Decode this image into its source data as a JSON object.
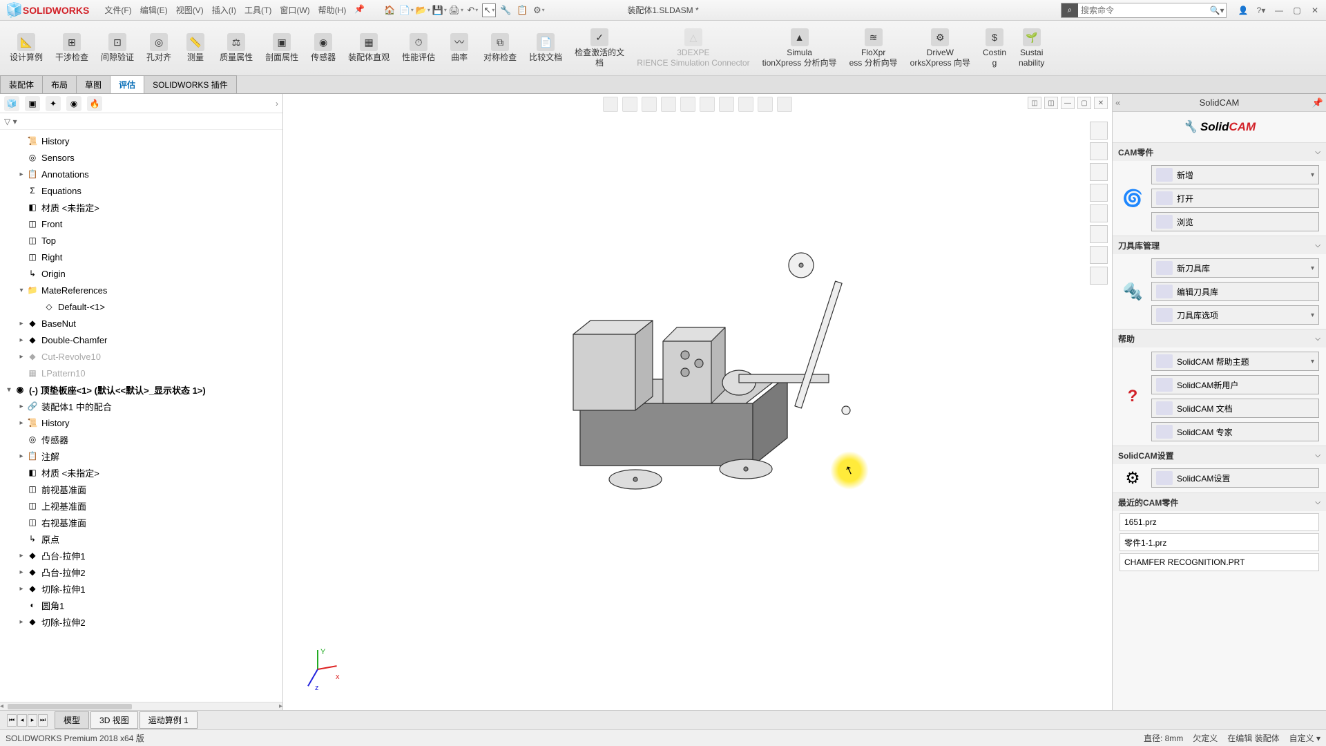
{
  "app": {
    "name": "SOLIDWORKS",
    "doc_title": "装配体1.SLDASM *"
  },
  "menu": [
    "文件(F)",
    "编辑(E)",
    "视图(V)",
    "插入(I)",
    "工具(T)",
    "窗口(W)",
    "帮助(H)"
  ],
  "search": {
    "placeholder": "搜索命令"
  },
  "ribbon": [
    {
      "lbl": "设计算例",
      "ic": "📐"
    },
    {
      "lbl": "干涉检查",
      "ic": "⊞"
    },
    {
      "lbl": "间隙验证",
      "ic": "⊡"
    },
    {
      "lbl": "孔对齐",
      "ic": "◎"
    },
    {
      "lbl": "测量",
      "ic": "📏"
    },
    {
      "lbl": "质量属性",
      "ic": "⚖"
    },
    {
      "lbl": "剖面属性",
      "ic": "▣"
    },
    {
      "lbl": "传感器",
      "ic": "◉"
    },
    {
      "lbl": "装配体直观",
      "ic": "▦"
    },
    {
      "lbl": "性能评估",
      "ic": "⏱"
    },
    {
      "lbl": "曲率",
      "ic": "〰"
    },
    {
      "lbl": "对称检查",
      "ic": "⧉"
    },
    {
      "lbl": "比较文档",
      "ic": "📄"
    },
    {
      "lbl": "检查激活的文档",
      "ic": "✓"
    },
    {
      "lbl": "3DEXPERIENCE Simulation Connector",
      "ic": "△",
      "dis": true
    },
    {
      "lbl": "SimulationXpress 分析向导",
      "ic": "▲"
    },
    {
      "lbl": "FloXpress 分析向导",
      "ic": "≋"
    },
    {
      "lbl": "DriveWorksXpress 向导",
      "ic": "⚙"
    },
    {
      "lbl": "Costing",
      "ic": "$"
    },
    {
      "lbl": "Sustainability",
      "ic": "🌱"
    }
  ],
  "tabs": [
    "装配体",
    "布局",
    "草图",
    "评估",
    "SOLIDWORKS 插件"
  ],
  "active_tab": 3,
  "tree": [
    {
      "lvl": 1,
      "exp": "",
      "ic": "📜",
      "txt": "History"
    },
    {
      "lvl": 1,
      "exp": "",
      "ic": "◎",
      "txt": "Sensors"
    },
    {
      "lvl": 1,
      "exp": "▸",
      "ic": "📋",
      "txt": "Annotations"
    },
    {
      "lvl": 1,
      "exp": "",
      "ic": "Σ",
      "txt": "Equations"
    },
    {
      "lvl": 1,
      "exp": "",
      "ic": "◧",
      "txt": "材质 <未指定>"
    },
    {
      "lvl": 1,
      "exp": "",
      "ic": "◫",
      "txt": "Front"
    },
    {
      "lvl": 1,
      "exp": "",
      "ic": "◫",
      "txt": "Top"
    },
    {
      "lvl": 1,
      "exp": "",
      "ic": "◫",
      "txt": "Right"
    },
    {
      "lvl": 1,
      "exp": "",
      "ic": "↳",
      "txt": "Origin"
    },
    {
      "lvl": 1,
      "exp": "▾",
      "ic": "📁",
      "txt": "MateReferences"
    },
    {
      "lvl": 2,
      "exp": "",
      "ic": "◇",
      "txt": "Default-<1>"
    },
    {
      "lvl": 1,
      "exp": "▸",
      "ic": "◆",
      "txt": "BaseNut"
    },
    {
      "lvl": 1,
      "exp": "▸",
      "ic": "◆",
      "txt": "Double-Chamfer"
    },
    {
      "lvl": 1,
      "exp": "▸",
      "ic": "◆",
      "txt": "Cut-Revolve10",
      "dim": true
    },
    {
      "lvl": 1,
      "exp": "",
      "ic": "▦",
      "txt": "LPattern10",
      "dim": true
    },
    {
      "lvl": 0,
      "exp": "▾",
      "ic": "◉",
      "txt": "(-) 顶垫板座<1> (默认<<默认>_显示状态 1>)",
      "bold": true
    },
    {
      "lvl": 1,
      "exp": "▸",
      "ic": "🔗",
      "txt": "装配体1 中的配合"
    },
    {
      "lvl": 1,
      "exp": "▸",
      "ic": "📜",
      "txt": "History"
    },
    {
      "lvl": 1,
      "exp": "",
      "ic": "◎",
      "txt": "传感器"
    },
    {
      "lvl": 1,
      "exp": "▸",
      "ic": "📋",
      "txt": "注解"
    },
    {
      "lvl": 1,
      "exp": "",
      "ic": "◧",
      "txt": "材质 <未指定>"
    },
    {
      "lvl": 1,
      "exp": "",
      "ic": "◫",
      "txt": "前视基准面"
    },
    {
      "lvl": 1,
      "exp": "",
      "ic": "◫",
      "txt": "上视基准面"
    },
    {
      "lvl": 1,
      "exp": "",
      "ic": "◫",
      "txt": "右视基准面"
    },
    {
      "lvl": 1,
      "exp": "",
      "ic": "↳",
      "txt": "原点"
    },
    {
      "lvl": 1,
      "exp": "▸",
      "ic": "◆",
      "txt": "凸台-拉伸1"
    },
    {
      "lvl": 1,
      "exp": "▸",
      "ic": "◆",
      "txt": "凸台-拉伸2"
    },
    {
      "lvl": 1,
      "exp": "▸",
      "ic": "◆",
      "txt": "切除-拉伸1"
    },
    {
      "lvl": 1,
      "exp": "",
      "ic": "◐",
      "txt": "圆角1"
    },
    {
      "lvl": 1,
      "exp": "▸",
      "ic": "◆",
      "txt": "切除-拉伸2"
    }
  ],
  "right": {
    "title": "SolidCAM",
    "logo_a": "Solid",
    "logo_b": "CAM",
    "sections": {
      "cam_part": {
        "hdr": "CAM零件",
        "btns": [
          "新增",
          "打开",
          "浏览"
        ]
      },
      "tool_lib": {
        "hdr": "刀具库管理",
        "btns": [
          "新刀具库",
          "编辑刀具库",
          "刀具库选项"
        ]
      },
      "help": {
        "hdr": "帮助",
        "btns": [
          "SolidCAM 帮助主题",
          "SolidCAM新用户",
          "SolidCAM 文档",
          "SolidCAM 专家"
        ]
      },
      "settings": {
        "hdr": "SolidCAM设置",
        "btns": [
          "SolidCAM设置"
        ]
      },
      "recent": {
        "hdr": "最近的CAM零件",
        "items": [
          "1651.prz",
          "零件1-1.prz",
          "CHAMFER RECOGNITION.PRT"
        ]
      }
    }
  },
  "btabs": [
    "模型",
    "3D 视图",
    "运动算例 1"
  ],
  "status": {
    "left": "SOLIDWORKS Premium 2018 x64 版",
    "r1": "直径: 8mm",
    "r2": "欠定义",
    "r3": "在编辑 装配体",
    "r4": "自定义 ▾"
  },
  "triad": {
    "x": "x",
    "y": "Y",
    "z": "z"
  }
}
